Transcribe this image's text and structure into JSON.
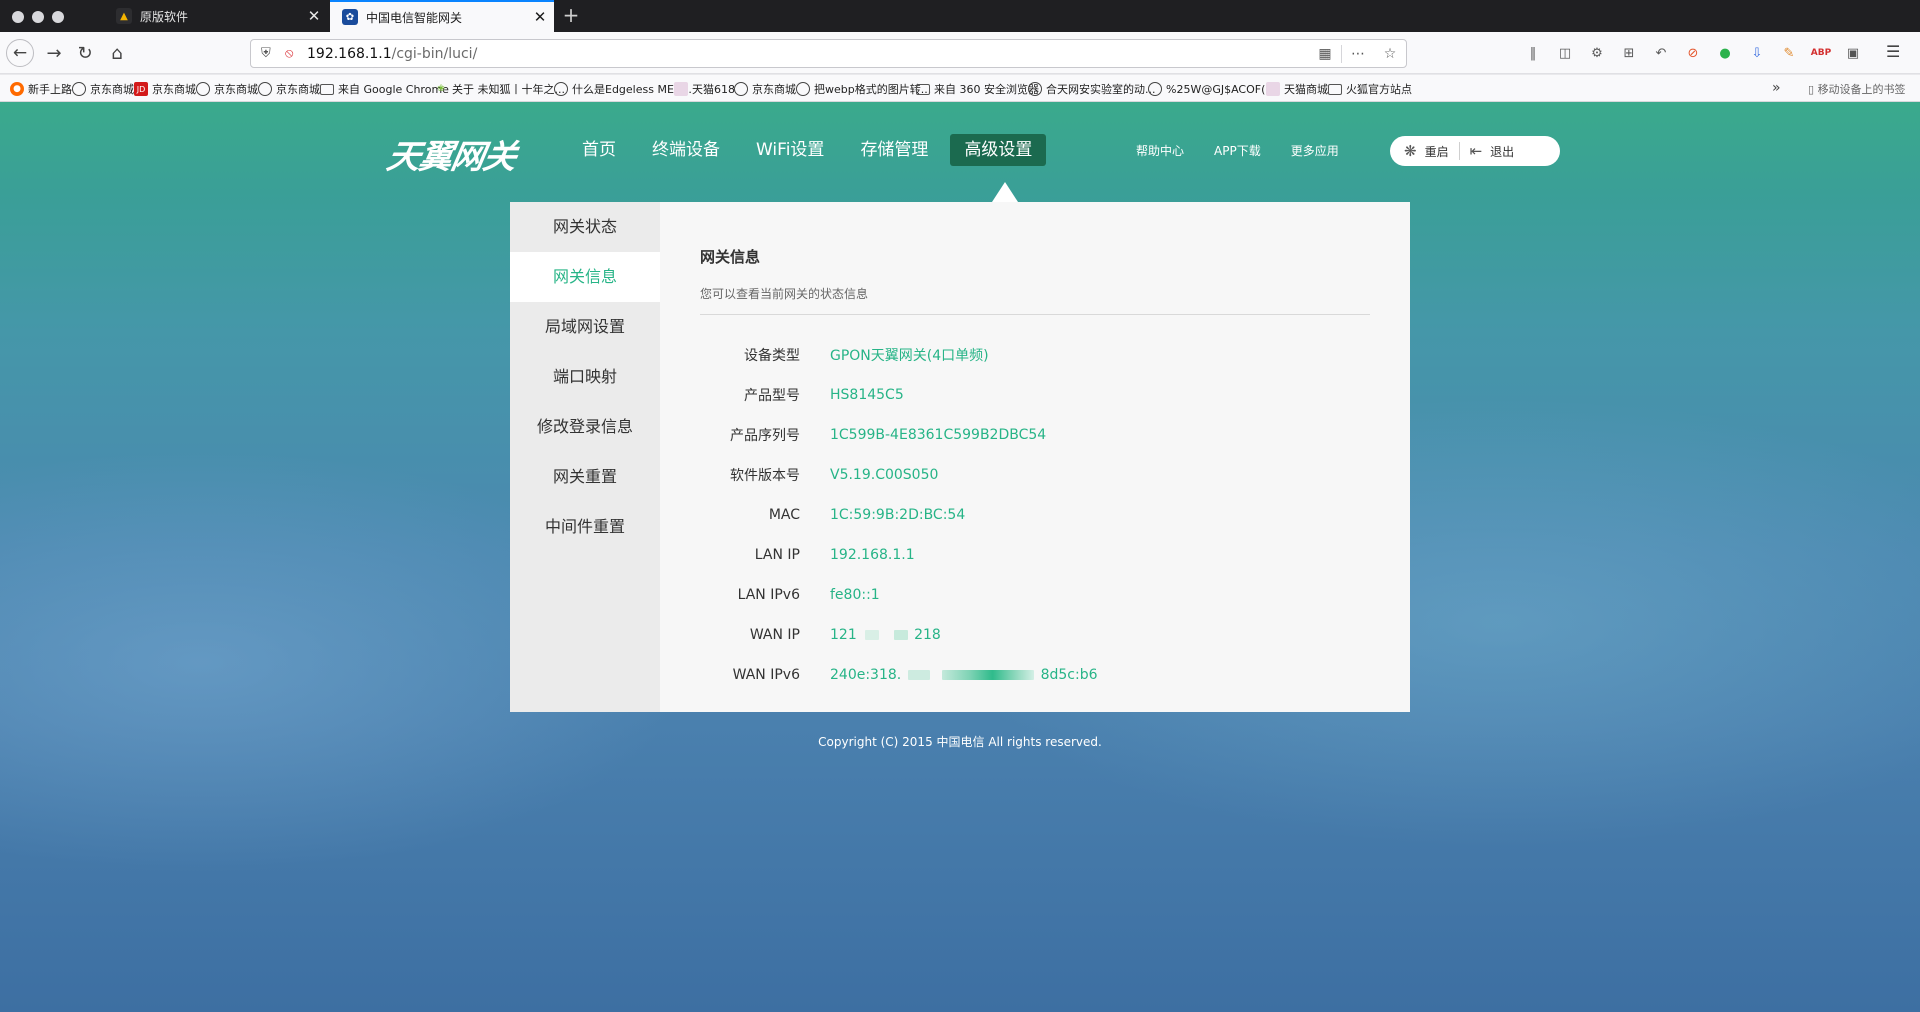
{
  "browser": {
    "tabs": [
      {
        "title": "原版软件",
        "active": false
      },
      {
        "title": "中国电信智能网关",
        "active": true
      }
    ],
    "url": {
      "host": "192.168.1.1",
      "path": "/cgi-bin/luci/"
    },
    "bookmarks": [
      {
        "label": "新手上路",
        "icon": "firefox-icon"
      },
      {
        "label": "京东商城",
        "icon": "globe-icon"
      },
      {
        "label": "京东商城",
        "icon": "jd-icon"
      },
      {
        "label": "京东商城",
        "icon": "globe-icon"
      },
      {
        "label": "京东商城",
        "icon": "globe-icon"
      },
      {
        "label": "来自 Google Chrome",
        "icon": "folder-icon"
      },
      {
        "label": "关于 未知狐丨十年之...",
        "icon": "leaf-icon"
      },
      {
        "label": "什么是Edgeless ME -...",
        "icon": "globe-icon"
      },
      {
        "label": "天猫618",
        "icon": "image-icon"
      },
      {
        "label": "京东商城",
        "icon": "globe-icon"
      },
      {
        "label": "把webp格式的图片转...",
        "icon": "globe-icon"
      },
      {
        "label": "来自 360 安全浏览器",
        "icon": "folder-icon"
      },
      {
        "label": "合天网安实验室的动...",
        "icon": "globe-icon"
      },
      {
        "label": "%25W@GJ$ACOF(...",
        "icon": "globe-icon"
      },
      {
        "label": "天猫商城",
        "icon": "image-icon"
      },
      {
        "label": "火狐官方站点",
        "icon": "folder-icon"
      }
    ],
    "mobile_bookmarks": "移动设备上的书签"
  },
  "gateway": {
    "logo": "天翼网关",
    "nav": [
      {
        "label": "首页",
        "active": false
      },
      {
        "label": "终端设备",
        "active": false
      },
      {
        "label": "WiFi设置",
        "active": false
      },
      {
        "label": "存储管理",
        "active": false
      },
      {
        "label": "高级设置",
        "active": true
      }
    ],
    "top_links": [
      "帮助中心",
      "APP下载",
      "更多应用"
    ],
    "restart_label": "重启",
    "logout_label": "退出",
    "side_menu": [
      {
        "label": "网关状态",
        "active": false
      },
      {
        "label": "网关信息",
        "active": true
      },
      {
        "label": "局域网设置",
        "active": false
      },
      {
        "label": "端口映射",
        "active": false
      },
      {
        "label": "修改登录信息",
        "active": false
      },
      {
        "label": "网关重置",
        "active": false
      },
      {
        "label": "中间件重置",
        "active": false
      }
    ],
    "content": {
      "title": "网关信息",
      "description": "您可以查看当前网关的状态信息",
      "rows": [
        {
          "label": "设备类型",
          "value": "GPON天翼网关(4口单频)"
        },
        {
          "label": "产品型号",
          "value": "HS8145C5"
        },
        {
          "label": "产品序列号",
          "value": "1C599B-4E8361C599B2DBC54"
        },
        {
          "label": "软件版本号",
          "value": "V5.19.C00S050"
        },
        {
          "label": "MAC",
          "value": "1C:59:9B:2D:BC:54"
        },
        {
          "label": "LAN IP",
          "value": "192.168.1.1"
        },
        {
          "label": "LAN IPv6",
          "value": "fe80::1"
        },
        {
          "label": "WAN IP",
          "value_start": "121",
          "value_end": "218"
        },
        {
          "label": "WAN IPv6",
          "value_start": "240e:318.",
          "value_end": "8d5c:b6"
        }
      ]
    },
    "copyright": "Copyright (C) 2015 中国电信 All rights reserved."
  },
  "colors": {
    "accent": "#27b487",
    "active_nav": "#1b6a4f",
    "browser_tab_accent": "#0a84ff"
  }
}
